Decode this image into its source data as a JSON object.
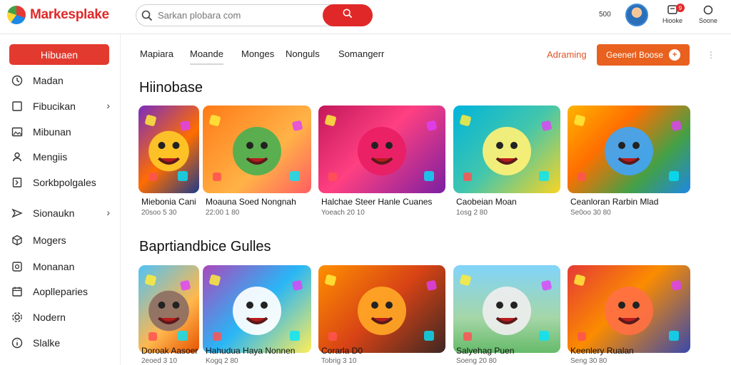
{
  "header": {
    "logo_text": "Markesplake",
    "search_placeholder": "Sarkan plobara com",
    "counter": "500",
    "notif_badge": "9",
    "notif_label": "Hiooke",
    "settings_label": "Soone"
  },
  "sidebar": {
    "primary": "Hibuaen",
    "items": [
      {
        "label": "Madan",
        "icon": "clock-icon",
        "chevron": false
      },
      {
        "label": "Fibucikan",
        "icon": "square-icon",
        "chevron": true
      },
      {
        "label": "Mibunan",
        "icon": "image-icon",
        "chevron": false
      },
      {
        "label": "Mengiis",
        "icon": "user-icon",
        "chevron": false
      },
      {
        "label": "Sorkbpolgales",
        "icon": "bookmark-icon",
        "chevron": false
      },
      {
        "label": "Sionaukn",
        "icon": "send-icon",
        "chevron": true
      },
      {
        "label": "Mogers",
        "icon": "cube-icon",
        "chevron": false
      },
      {
        "label": "Monanan",
        "icon": "phone-icon",
        "chevron": false
      },
      {
        "label": "Aoplleparies",
        "icon": "calendar-icon",
        "chevron": false
      },
      {
        "label": "Nodern",
        "icon": "settings-icon",
        "chevron": false
      },
      {
        "label": "Slalke",
        "icon": "info-icon",
        "chevron": false
      }
    ]
  },
  "tabs": [
    "Mapiara",
    "Moande",
    "Monges",
    "Nonguls",
    "Somangerr"
  ],
  "actions": {
    "link": "Adraming",
    "cta": "Geenerl Boose"
  },
  "sections": [
    {
      "title": "Hiinobase",
      "cards": [
        {
          "title": "Miebonia Cani",
          "meta": "20soo 5 30"
        },
        {
          "title": "Moauna Soed Nongnah",
          "meta": "22:00 1 80"
        },
        {
          "title": "Halchae Steer Hanle Cuanes",
          "meta": "Yoeach 20 10"
        },
        {
          "title": "Caobeian Moan",
          "meta": "1osg 2 80"
        },
        {
          "title": "Ceanloran Rarbin Mlad",
          "meta": "Se0oo 30 80"
        }
      ]
    },
    {
      "title": "Baprtiandbice Gulles",
      "cards": [
        {
          "title": "Doroak Aasoer",
          "meta": "2eoed 3 10"
        },
        {
          "title": "Hahudua Haya Nonnen",
          "meta": "Kogq 2 80"
        },
        {
          "title": "Corarla D0",
          "meta": "Tobrig 3 10"
        },
        {
          "title": "Salyehag Puen",
          "meta": "Soeng 20 80"
        },
        {
          "title": "Keenlery Rualan",
          "meta": "Seng 30 80"
        }
      ]
    }
  ],
  "colors": {
    "brand": "#e02828",
    "cta": "#e8611f"
  }
}
